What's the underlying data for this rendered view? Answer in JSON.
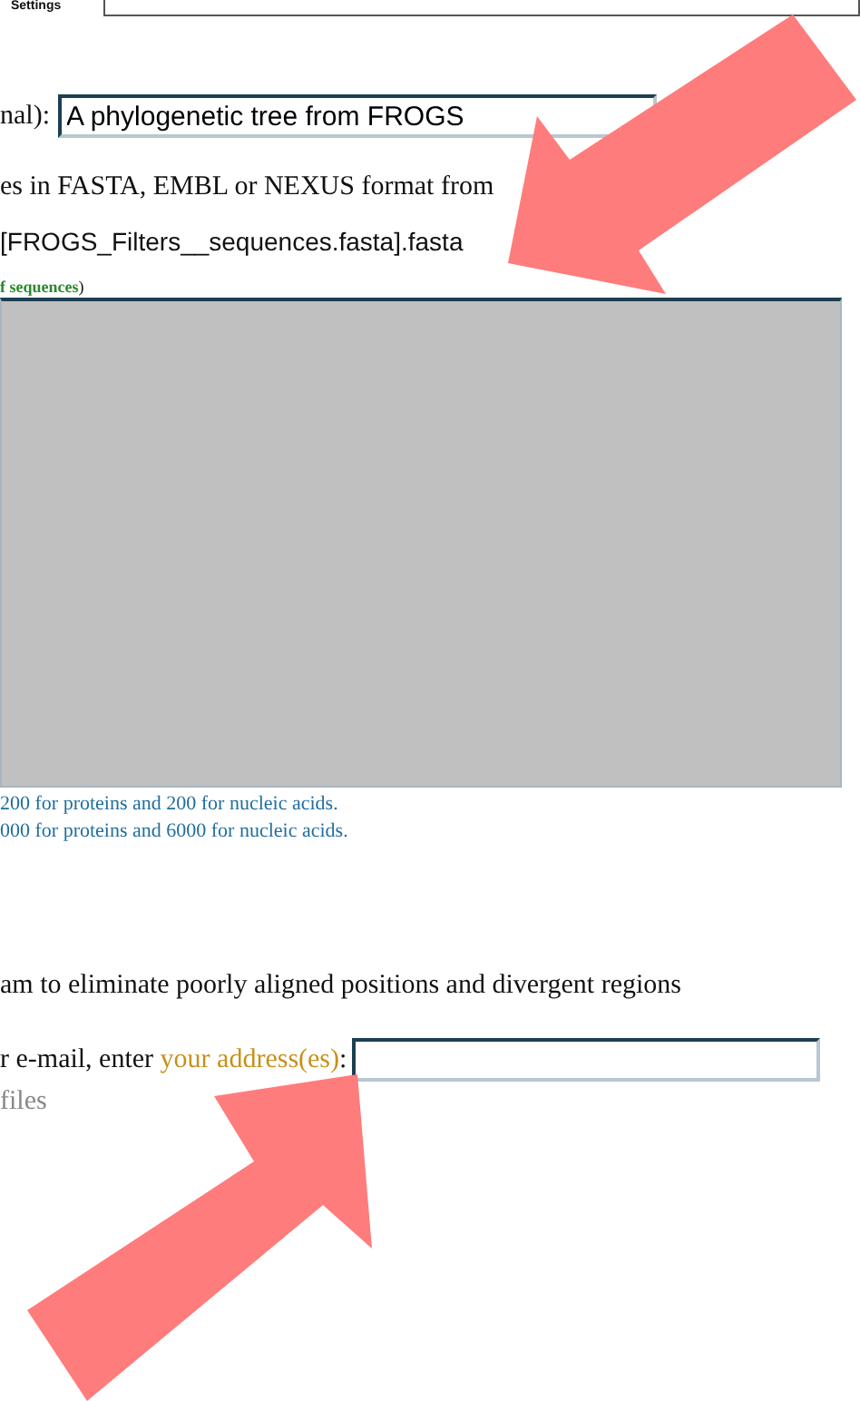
{
  "tab": {
    "label": "Settings"
  },
  "title_field": {
    "label": "nal):",
    "value": "A phylogenetic tree from FROGS"
  },
  "sequences": {
    "label": "es in FASTA, EMBL or NEXUS format from",
    "file": "[FROGS_Filters__sequences.fasta].fasta",
    "hint": "f sequences",
    "hint_end": ")"
  },
  "limits": [
    "200 for proteins and 200 for nucleic acids.",
    "000 for proteins and 6000 for nucleic acids."
  ],
  "option": {
    "label": "am to eliminate poorly aligned positions and divergent regions"
  },
  "email": {
    "label": "r e-mail, enter ",
    "link": "your address(es)",
    "colon": ":"
  },
  "files_note": "files"
}
